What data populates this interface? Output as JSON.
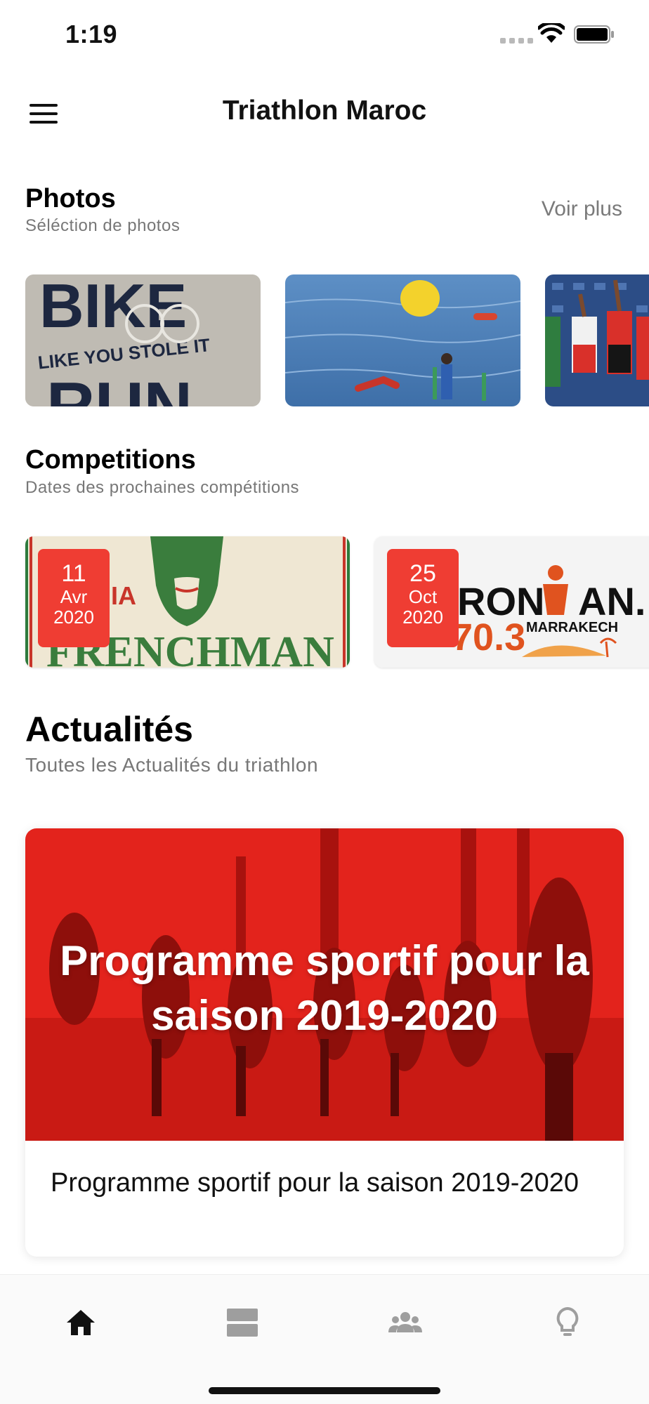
{
  "status_bar": {
    "time": "1:19",
    "icons": [
      "signal-dots-icon",
      "wifi-icon",
      "battery-icon"
    ]
  },
  "header": {
    "title": "Triathlon Maroc",
    "menu_icon": "hamburger-menu-icon"
  },
  "photos": {
    "title": "Photos",
    "subtitle": "Séléction de photos",
    "more_label": "Voir plus",
    "items": [
      {
        "description_icon": "photo-bike-run-shirt",
        "text_on_image": "BIKE LIKE YOU STOLE IT RUN"
      },
      {
        "description_icon": "photo-swim-buoy"
      },
      {
        "description_icon": "photo-podium"
      }
    ]
  },
  "competitions": {
    "title": "Competitions",
    "subtitle": "Dates des prochaines compétitions",
    "items": [
      {
        "day": "11",
        "month": "Avr",
        "year": "2020",
        "logo_text": "FRENCHMAN"
      },
      {
        "day": "25",
        "month": "Oct",
        "year": "2020",
        "logo_text": "IRONMAN 70.3 MARRAKECH"
      }
    ]
  },
  "news": {
    "title": "Actualités",
    "subtitle": "Toutes les Actualités du triathlon",
    "items": [
      {
        "image_text": "Programme sportif pour la saison 2019-2020",
        "title": "Programme sportif pour la saison 2019-2020"
      }
    ]
  },
  "bottom_nav": {
    "tabs": [
      {
        "icon": "home-icon",
        "active": true
      },
      {
        "icon": "list-icon",
        "active": false
      },
      {
        "icon": "group-icon",
        "active": false
      },
      {
        "icon": "lightbulb-icon",
        "active": false
      }
    ]
  },
  "colors": {
    "accent_red": "#ef3d33",
    "inactive_icon": "#9e9e9e",
    "active_icon": "#111111"
  }
}
